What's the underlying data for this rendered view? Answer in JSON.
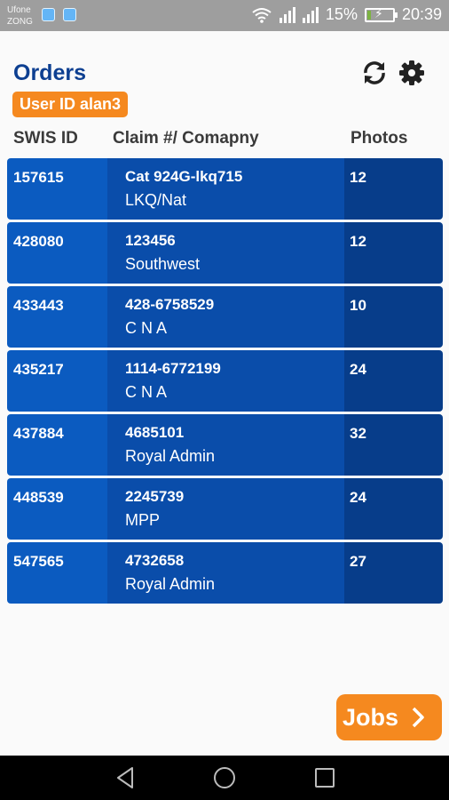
{
  "status_bar": {
    "carrier_1": "Ufone",
    "carrier_2": "ZONG",
    "battery_percent": "15%",
    "time": "20:39",
    "battery_level": 0.15,
    "icons": [
      "wifi-icon",
      "signal-icon",
      "battery-charging-icon"
    ]
  },
  "header": {
    "title": "Orders",
    "user_badge": "User ID alan3",
    "icons": [
      "refresh-icon",
      "settings-icon"
    ]
  },
  "columns": {
    "swis_id": "SWIS ID",
    "claim": "Claim #/ Comapny",
    "photos": "Photos"
  },
  "orders": [
    {
      "swis_id": "157615",
      "claim": "Cat 924G-lkq715",
      "company": "LKQ/Nat",
      "photos": "12"
    },
    {
      "swis_id": "428080",
      "claim": "123456",
      "company": "Southwest",
      "photos": "12"
    },
    {
      "swis_id": "433443",
      "claim": "428-6758529",
      "company": "C N A",
      "photos": "10"
    },
    {
      "swis_id": "435217",
      "claim": "1114-6772199",
      "company": "C N A",
      "photos": "24"
    },
    {
      "swis_id": "437884",
      "claim": "4685101",
      "company": "Royal Admin",
      "photos": "32"
    },
    {
      "swis_id": "448539",
      "claim": "2245739",
      "company": "MPP",
      "photos": "24"
    },
    {
      "swis_id": "547565",
      "claim": "4732658",
      "company": "Royal Admin",
      "photos": "27"
    }
  ],
  "jobs_button": {
    "label": "Jobs",
    "icon": "chevron-right-icon"
  },
  "nav": {
    "icons": [
      "back-icon",
      "home-icon",
      "recents-icon"
    ]
  },
  "colors": {
    "accent": "#f5891f",
    "primary": "#0d3f91",
    "row_blue": "#0b5bc0"
  }
}
